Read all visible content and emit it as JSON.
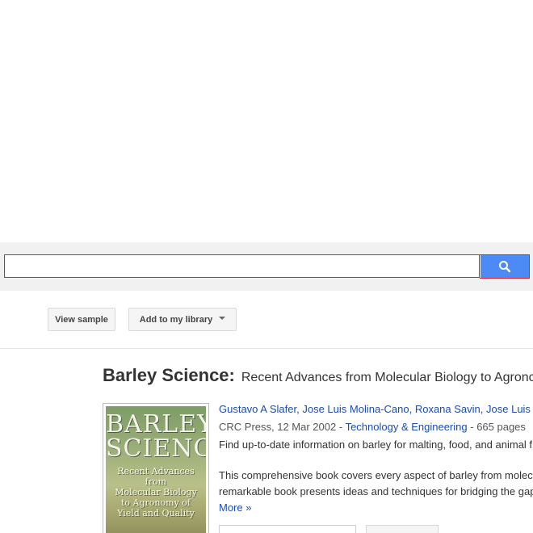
{
  "search": {
    "value": "",
    "placeholder": "",
    "button_icon": "search-icon"
  },
  "toolbar": {
    "view_sample_label": "View sample",
    "add_library_label": "Add to my library"
  },
  "book": {
    "title": "Barley Science",
    "subtitle": "Recent Advances from Molecular Biology to Agronc",
    "cover": {
      "title_line1": "BARLEY",
      "title_line2": "SCIENCE",
      "sub_line1": "Recent Advances from",
      "sub_line2": "Molecular Biology",
      "sub_line3": "to Agronomy of",
      "sub_line4": "Yield and Quality"
    },
    "authors": [
      "Gustavo A Slafer",
      "Jose Luis Molina-Cano",
      "Roxana Savin",
      "Jose Luis"
    ],
    "publisher_date": "CRC Press, 12 Mar 2002",
    "category": "Technology & Engineering",
    "pages": "665 pages",
    "description_line1": "Find up-to-date information on barley for malting, food, and animal f",
    "description_line2": "This comprehensive book covers every aspect of barley from molec",
    "description_line3": "remarkable book presents ideas and techniques for bridging the gap",
    "more_label": "More »"
  },
  "colors": {
    "search_button": "#4c8bf5",
    "search_border": "#dd1e2e",
    "link": "#1a4bb5"
  }
}
